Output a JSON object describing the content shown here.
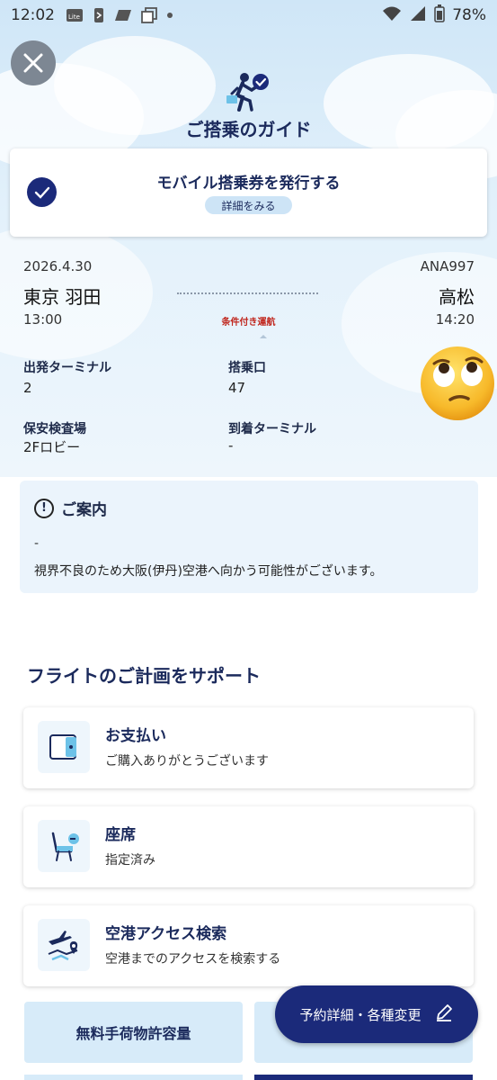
{
  "status_bar": {
    "time": "12:02",
    "battery": "78%"
  },
  "header": {
    "title": "ご搭乗のガイド"
  },
  "mobile_pass": {
    "title": "モバイル搭乗券を発行する",
    "detail_link": "詳細をみる"
  },
  "flight": {
    "date": "2026.4.30",
    "number": "ANA997",
    "from": "東京 羽田",
    "to": "高松",
    "departure_time": "13:00",
    "arrival_time": "14:20",
    "condition": "条件付き運航"
  },
  "info": {
    "departure_terminal_label": "出発ターミナル",
    "departure_terminal_value": "2",
    "gate_label": "搭乗口",
    "gate_value": "47",
    "security_label": "保安検査場",
    "security_value": "2Fロビー",
    "arrival_terminal_label": "到着ターミナル",
    "arrival_terminal_value": "-"
  },
  "notice": {
    "title": "ご案内",
    "line1": "-",
    "line2": "視界不良のため大阪(伊丹)空港へ向かう可能性がございます。"
  },
  "support": {
    "title": "フライトのご計画をサポート",
    "cards": [
      {
        "title": "お支払い",
        "subtitle": "ご購入ありがとうございます",
        "icon": "wallet-icon"
      },
      {
        "title": "座席",
        "subtitle": "指定済み",
        "icon": "seat-icon"
      },
      {
        "title": "空港アクセス検索",
        "subtitle": "空港までのアクセスを検索する",
        "icon": "airport-access-icon"
      }
    ]
  },
  "tiles": {
    "baggage": "無料手荷物許容量"
  },
  "fab": {
    "label": "予約詳細・各種変更"
  },
  "colors": {
    "navy": "#1b2a7a",
    "alert_red": "#c0261d",
    "light_blue": "#d7ebf9"
  }
}
